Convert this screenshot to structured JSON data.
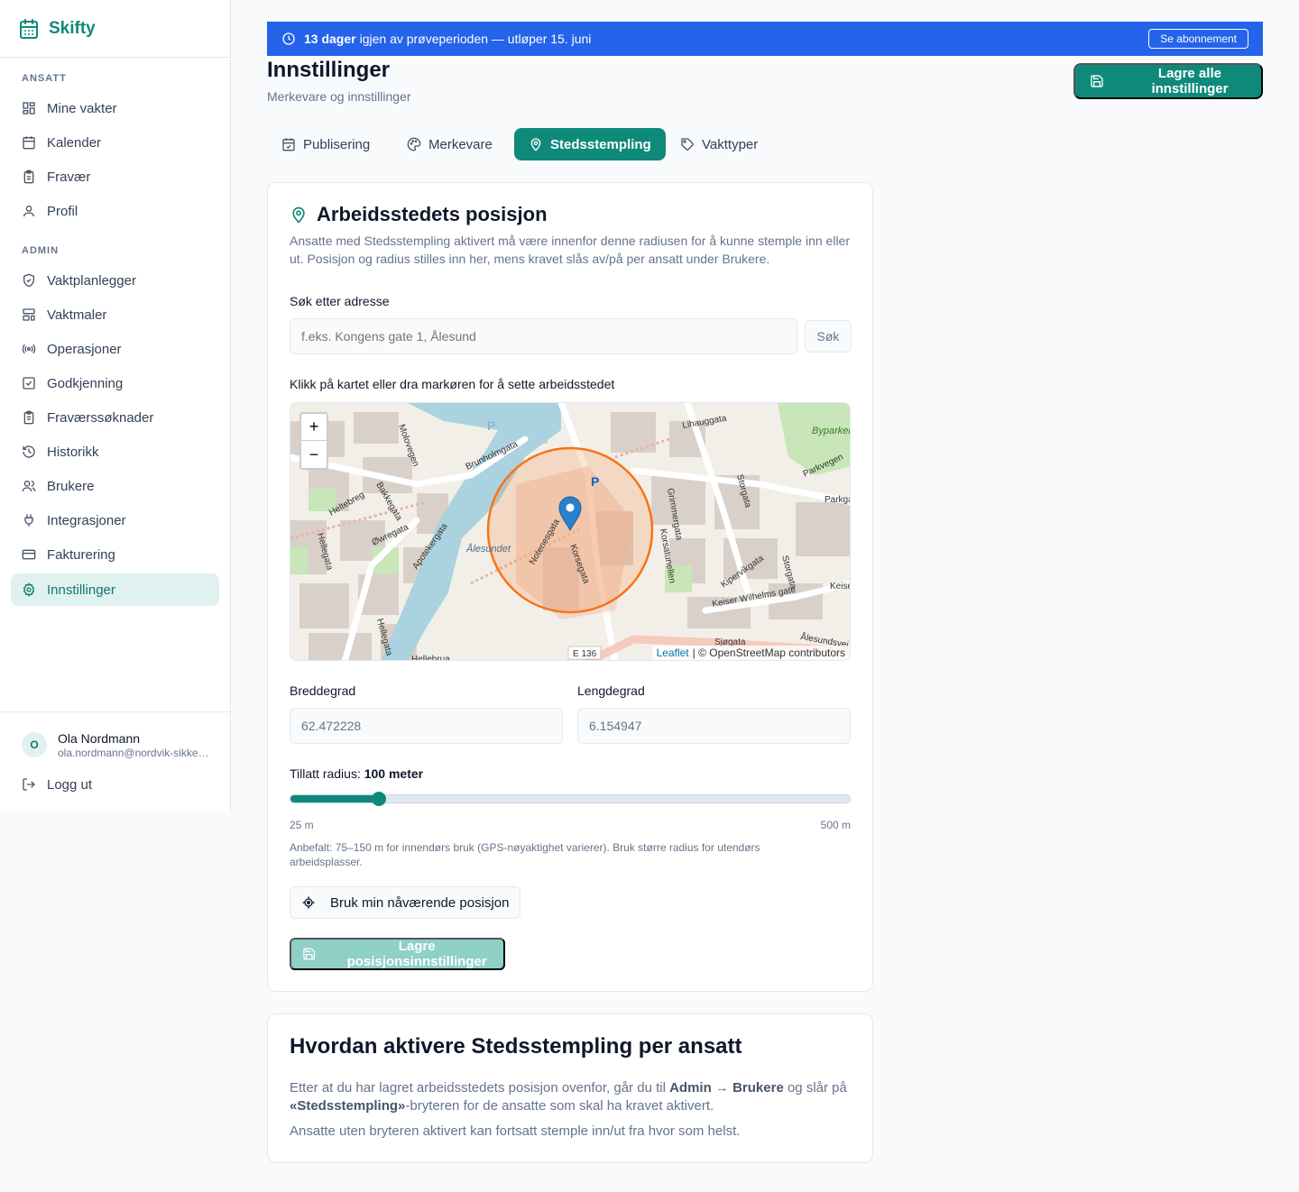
{
  "app": {
    "name": "Skifty"
  },
  "sidebar": {
    "section_ansatt": "ANSATT",
    "section_admin": "ADMIN",
    "ansatt_items": [
      {
        "label": "Mine vakter",
        "icon": "layout-grid-icon"
      },
      {
        "label": "Kalender",
        "icon": "calendar-icon"
      },
      {
        "label": "Fravær",
        "icon": "clipboard-icon"
      },
      {
        "label": "Profil",
        "icon": "user-icon"
      }
    ],
    "admin_items": [
      {
        "label": "Vaktplanlegger",
        "icon": "shield-icon"
      },
      {
        "label": "Vaktmaler",
        "icon": "layout-template-icon"
      },
      {
        "label": "Operasjoner",
        "icon": "radio-icon"
      },
      {
        "label": "Godkjenning",
        "icon": "check-square-icon"
      },
      {
        "label": "Fraværssøknader",
        "icon": "clipboard-list-icon"
      },
      {
        "label": "Historikk",
        "icon": "history-icon"
      },
      {
        "label": "Brukere",
        "icon": "users-icon"
      },
      {
        "label": "Integrasjoner",
        "icon": "plug-icon"
      },
      {
        "label": "Fakturering",
        "icon": "credit-card-icon"
      },
      {
        "label": "Innstillinger",
        "icon": "settings-icon",
        "active": true
      }
    ],
    "user": {
      "initial": "O",
      "name": "Ola Nordmann",
      "email": "ola.nordmann@nordvik-sikkerhet.no"
    },
    "logout": "Logg ut"
  },
  "banner": {
    "days": "13 dager",
    "text": "igjen av prøveperioden — utløper 15. juni",
    "button": "Se abonnement"
  },
  "header": {
    "title": "Innstillinger",
    "subtitle": "Merkevare og innstillinger",
    "save_all": "Lagre alle innstillinger"
  },
  "tabs": [
    {
      "label": "Publisering"
    },
    {
      "label": "Merkevare"
    },
    {
      "label": "Stedsstempling",
      "active": true
    },
    {
      "label": "Vakttyper"
    }
  ],
  "location_card": {
    "title": "Arbeidsstedets posisjon",
    "description": "Ansatte med Stedsstempling aktivert må være innenfor denne radiusen for å kunne stemple inn eller ut. Posisjon og radius stilles inn her, mens kravet slås av/på per ansatt under Brukere.",
    "search_label": "Søk etter adresse",
    "search_placeholder": "f.eks. Kongens gate 1, Ålesund",
    "search_button": "Søk",
    "map_label": "Klikk på kartet eller dra markøren for å sette arbeidsstedet",
    "map": {
      "zoom_in": "+",
      "zoom_out": "−",
      "attribution_leaflet": "Leaflet",
      "attribution_rest": "| © OpenStreetMap contributors",
      "labels": [
        "Lihauggata",
        "Byparken",
        "Parkvegen",
        "Parkgata",
        "Brunholmgata",
        "Molovegen",
        "Bakkegata",
        "Heltebreg",
        "Øwregata",
        "Hellegata",
        "Apotekergata",
        "Ålesundet",
        "Notenesgata",
        "Korsegata",
        "Grimmergata",
        "Korsatunellen",
        "Storgata",
        "Kipervikgata",
        "Keiser Wilhelms gate",
        "Ålesundsvei",
        "Hellebrua",
        "E 136",
        "Keise",
        "Sjøgata"
      ]
    },
    "lat_label": "Breddegrad",
    "lat_value": "62.472228",
    "lng_label": "Lengdegrad",
    "lng_value": "6.154947",
    "radius_label": "Tillatt radius:",
    "radius_value": "100 meter",
    "radius_min_label": "25 m",
    "radius_max_label": "500 m",
    "radius_meters": 100,
    "radius_min": 25,
    "radius_max": 500,
    "hint": "Anbefalt: 75–150 m for innendørs bruk (GPS-nøyaktighet varierer). Bruk større radius for utendørs arbeidsplasser.",
    "use_position": "Bruk min nåværende posisjon",
    "save_position": "Lagre posisjonsinnstillinger"
  },
  "howto_card": {
    "title": "Hvordan aktivere Stedsstempling per ansatt",
    "p1_a": "Etter at du har lagret arbeidsstedets posisjon ovenfor, går du til ",
    "p1_admin": "Admin",
    "p1_arrow": " → ",
    "p1_brukere": "Brukere",
    "p1_b": " og slår på ",
    "p1_switch": "«Stedsstempling»",
    "p1_c": "-bryteren for de ansatte som skal ha kravet aktivert.",
    "p2": "Ansatte uten bryteren aktivert kan fortsatt stemple inn/ut fra hvor som helst."
  },
  "colors": {
    "brand": "#0f8a7a",
    "banner": "#2563eb",
    "radius_circle": "#f97316",
    "marker": "#2a81cb"
  }
}
